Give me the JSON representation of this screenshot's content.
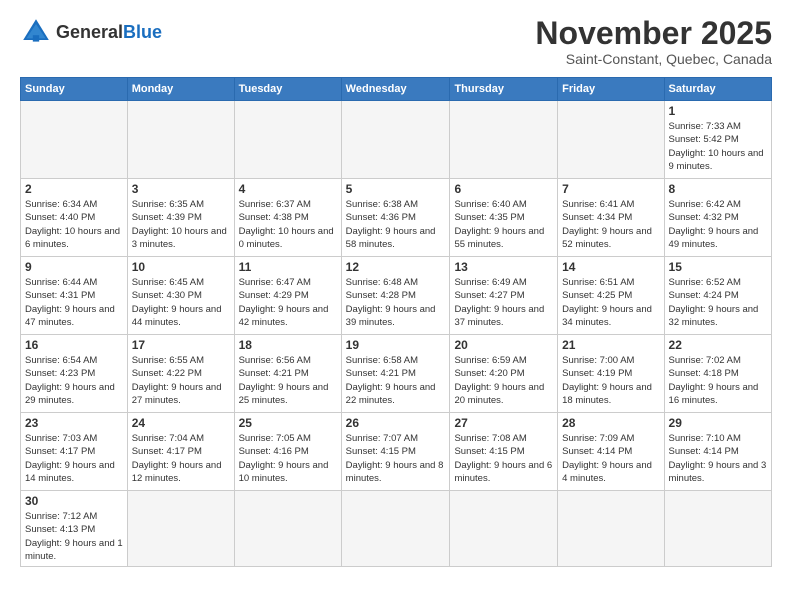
{
  "logo": {
    "text_general": "General",
    "text_blue": "Blue"
  },
  "title": "November 2025",
  "subtitle": "Saint-Constant, Quebec, Canada",
  "days_of_week": [
    "Sunday",
    "Monday",
    "Tuesday",
    "Wednesday",
    "Thursday",
    "Friday",
    "Saturday"
  ],
  "weeks": [
    [
      {
        "day": "",
        "info": ""
      },
      {
        "day": "",
        "info": ""
      },
      {
        "day": "",
        "info": ""
      },
      {
        "day": "",
        "info": ""
      },
      {
        "day": "",
        "info": ""
      },
      {
        "day": "",
        "info": ""
      },
      {
        "day": "1",
        "info": "Sunrise: 7:33 AM\nSunset: 5:42 PM\nDaylight: 10 hours\nand 9 minutes."
      }
    ],
    [
      {
        "day": "2",
        "info": "Sunrise: 6:34 AM\nSunset: 4:40 PM\nDaylight: 10 hours\nand 6 minutes."
      },
      {
        "day": "3",
        "info": "Sunrise: 6:35 AM\nSunset: 4:39 PM\nDaylight: 10 hours\nand 3 minutes."
      },
      {
        "day": "4",
        "info": "Sunrise: 6:37 AM\nSunset: 4:38 PM\nDaylight: 10 hours\nand 0 minutes."
      },
      {
        "day": "5",
        "info": "Sunrise: 6:38 AM\nSunset: 4:36 PM\nDaylight: 9 hours\nand 58 minutes."
      },
      {
        "day": "6",
        "info": "Sunrise: 6:40 AM\nSunset: 4:35 PM\nDaylight: 9 hours\nand 55 minutes."
      },
      {
        "day": "7",
        "info": "Sunrise: 6:41 AM\nSunset: 4:34 PM\nDaylight: 9 hours\nand 52 minutes."
      },
      {
        "day": "8",
        "info": "Sunrise: 6:42 AM\nSunset: 4:32 PM\nDaylight: 9 hours\nand 49 minutes."
      }
    ],
    [
      {
        "day": "9",
        "info": "Sunrise: 6:44 AM\nSunset: 4:31 PM\nDaylight: 9 hours\nand 47 minutes."
      },
      {
        "day": "10",
        "info": "Sunrise: 6:45 AM\nSunset: 4:30 PM\nDaylight: 9 hours\nand 44 minutes."
      },
      {
        "day": "11",
        "info": "Sunrise: 6:47 AM\nSunset: 4:29 PM\nDaylight: 9 hours\nand 42 minutes."
      },
      {
        "day": "12",
        "info": "Sunrise: 6:48 AM\nSunset: 4:28 PM\nDaylight: 9 hours\nand 39 minutes."
      },
      {
        "day": "13",
        "info": "Sunrise: 6:49 AM\nSunset: 4:27 PM\nDaylight: 9 hours\nand 37 minutes."
      },
      {
        "day": "14",
        "info": "Sunrise: 6:51 AM\nSunset: 4:25 PM\nDaylight: 9 hours\nand 34 minutes."
      },
      {
        "day": "15",
        "info": "Sunrise: 6:52 AM\nSunset: 4:24 PM\nDaylight: 9 hours\nand 32 minutes."
      }
    ],
    [
      {
        "day": "16",
        "info": "Sunrise: 6:54 AM\nSunset: 4:23 PM\nDaylight: 9 hours\nand 29 minutes."
      },
      {
        "day": "17",
        "info": "Sunrise: 6:55 AM\nSunset: 4:22 PM\nDaylight: 9 hours\nand 27 minutes."
      },
      {
        "day": "18",
        "info": "Sunrise: 6:56 AM\nSunset: 4:21 PM\nDaylight: 9 hours\nand 25 minutes."
      },
      {
        "day": "19",
        "info": "Sunrise: 6:58 AM\nSunset: 4:21 PM\nDaylight: 9 hours\nand 22 minutes."
      },
      {
        "day": "20",
        "info": "Sunrise: 6:59 AM\nSunset: 4:20 PM\nDaylight: 9 hours\nand 20 minutes."
      },
      {
        "day": "21",
        "info": "Sunrise: 7:00 AM\nSunset: 4:19 PM\nDaylight: 9 hours\nand 18 minutes."
      },
      {
        "day": "22",
        "info": "Sunrise: 7:02 AM\nSunset: 4:18 PM\nDaylight: 9 hours\nand 16 minutes."
      }
    ],
    [
      {
        "day": "23",
        "info": "Sunrise: 7:03 AM\nSunset: 4:17 PM\nDaylight: 9 hours\nand 14 minutes."
      },
      {
        "day": "24",
        "info": "Sunrise: 7:04 AM\nSunset: 4:17 PM\nDaylight: 9 hours\nand 12 minutes."
      },
      {
        "day": "25",
        "info": "Sunrise: 7:05 AM\nSunset: 4:16 PM\nDaylight: 9 hours\nand 10 minutes."
      },
      {
        "day": "26",
        "info": "Sunrise: 7:07 AM\nSunset: 4:15 PM\nDaylight: 9 hours\nand 8 minutes."
      },
      {
        "day": "27",
        "info": "Sunrise: 7:08 AM\nSunset: 4:15 PM\nDaylight: 9 hours\nand 6 minutes."
      },
      {
        "day": "28",
        "info": "Sunrise: 7:09 AM\nSunset: 4:14 PM\nDaylight: 9 hours\nand 4 minutes."
      },
      {
        "day": "29",
        "info": "Sunrise: 7:10 AM\nSunset: 4:14 PM\nDaylight: 9 hours\nand 3 minutes."
      }
    ],
    [
      {
        "day": "30",
        "info": "Sunrise: 7:12 AM\nSunset: 4:13 PM\nDaylight: 9 hours\nand 1 minute."
      },
      {
        "day": "",
        "info": ""
      },
      {
        "day": "",
        "info": ""
      },
      {
        "day": "",
        "info": ""
      },
      {
        "day": "",
        "info": ""
      },
      {
        "day": "",
        "info": ""
      },
      {
        "day": "",
        "info": ""
      }
    ]
  ]
}
